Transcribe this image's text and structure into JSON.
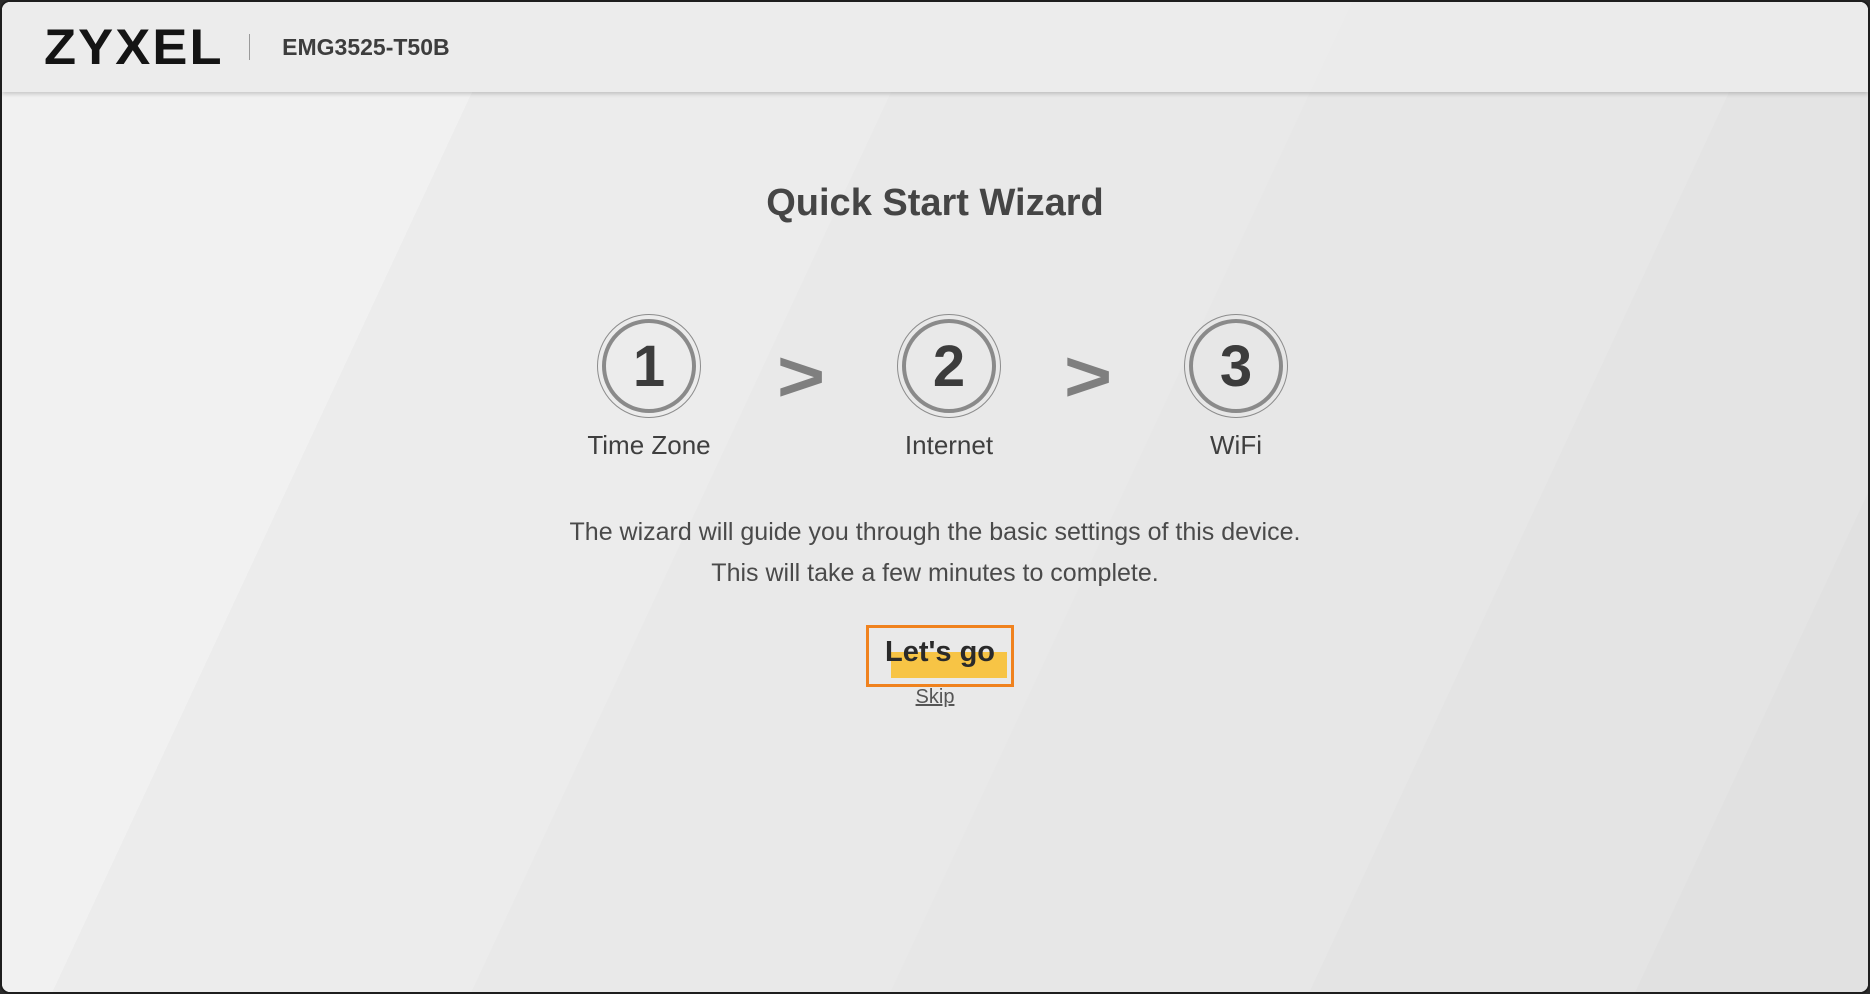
{
  "header": {
    "logo_text": "ZYXEL",
    "model": "EMG3525-T50B"
  },
  "wizard": {
    "title": "Quick Start Wizard",
    "steps": [
      {
        "number": "1",
        "label": "Time Zone"
      },
      {
        "number": "2",
        "label": "Internet"
      },
      {
        "number": "3",
        "label": "WiFi"
      }
    ],
    "separator": ">",
    "description_line1": "The wizard will guide you through the basic settings of this device.",
    "description_line2": "This will take a few minutes to complete.",
    "go_label": "Let's go",
    "skip_label": "Skip"
  },
  "colors": {
    "button_outline": "#f0821e",
    "button_highlight": "#f7c445"
  }
}
